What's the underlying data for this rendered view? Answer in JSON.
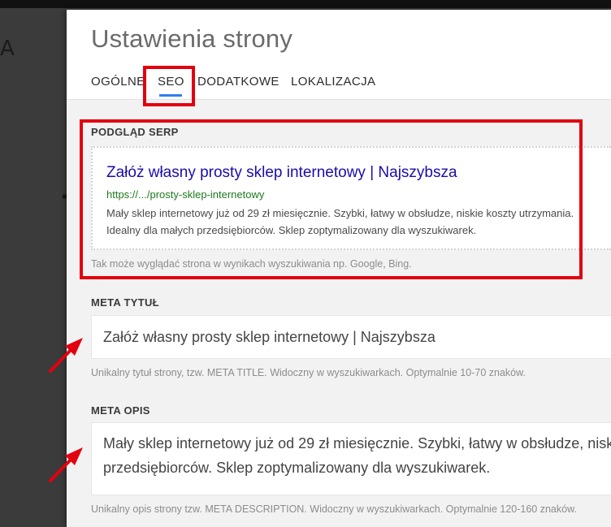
{
  "background": {
    "letter": "A",
    "glyph": "7"
  },
  "modal": {
    "title": "Ustawienia strony",
    "tabs": [
      {
        "label": "OGÓLNE",
        "active": false
      },
      {
        "label": "SEO",
        "active": true
      },
      {
        "label": "DODATKOWE",
        "active": false
      },
      {
        "label": "LOKALIZACJA",
        "active": false
      }
    ]
  },
  "serp": {
    "label": "PODGLĄD SERP",
    "title": "Załóż własny prosty sklep internetowy | Najszybsza",
    "url": "https://.../prosty-sklep-internetowy",
    "description": "Mały sklep internetowy już od 29 zł miesięcznie. Szybki, łatwy w obsłudze, niskie koszty utrzymania. Idealny dla małych przedsiębiorców. Sklep zoptymalizowany dla wyszukiwarek.",
    "help": "Tak może wyglądać strona w wynikach wyszukiwania np. Google, Bing."
  },
  "meta_title": {
    "label": "META TYTUŁ",
    "value": "Załóż własny prosty sklep internetowy | Najszybsza",
    "help": "Unikalny tytuł strony, tzw. META TITLE. Widoczny w wyszukiwarkach. Optymalnie 10-70 znaków."
  },
  "meta_description": {
    "label": "META OPIS",
    "value": "Mały sklep internetowy już od 29 zł miesięcznie. Szybki, łatwy w obsłudze, niskie koszty utrzymania. Idealny dla małych\nprzedsiębiorców. Sklep zoptymalizowany dla wyszukiwarek.",
    "help": "Unikalny opis strony tzw. META DESCRIPTION. Widoczny w wyszukiwarkach. Optymalnie 120-160 znaków."
  },
  "colors": {
    "accent": "#2f80ed",
    "annotation": "#e3000f",
    "link": "#1a0dab",
    "url": "#1f7a1f"
  }
}
